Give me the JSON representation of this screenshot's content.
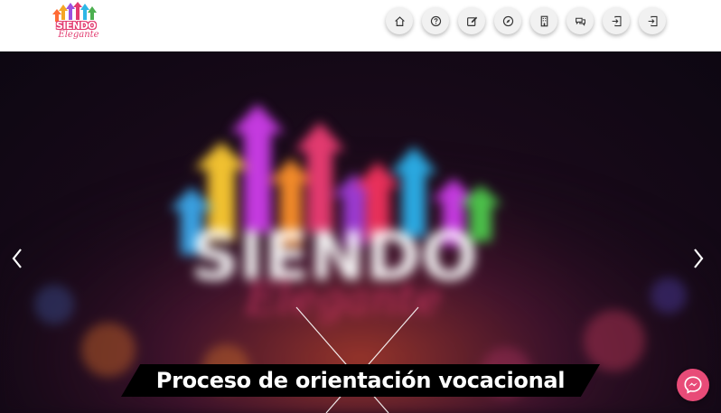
{
  "brand": {
    "logo_word": "SIENDO",
    "logo_script": "Elegante",
    "accent_color": "#e23a6f"
  },
  "nav": {
    "items": [
      {
        "icon": "home-icon"
      },
      {
        "icon": "help-circle-icon"
      },
      {
        "icon": "edit-icon"
      },
      {
        "icon": "compass-icon"
      },
      {
        "icon": "building-icon"
      },
      {
        "icon": "chat-icon"
      },
      {
        "icon": "login-icon"
      },
      {
        "icon": "login-icon"
      }
    ]
  },
  "hero": {
    "caption": "Proceso de orientación vocacional",
    "background_text": "SIENDO",
    "prev_icon": "chevron-left-icon",
    "next_icon": "chevron-right-icon"
  },
  "chat_widget": {
    "icon": "messenger-icon",
    "color": "#e84b78"
  }
}
